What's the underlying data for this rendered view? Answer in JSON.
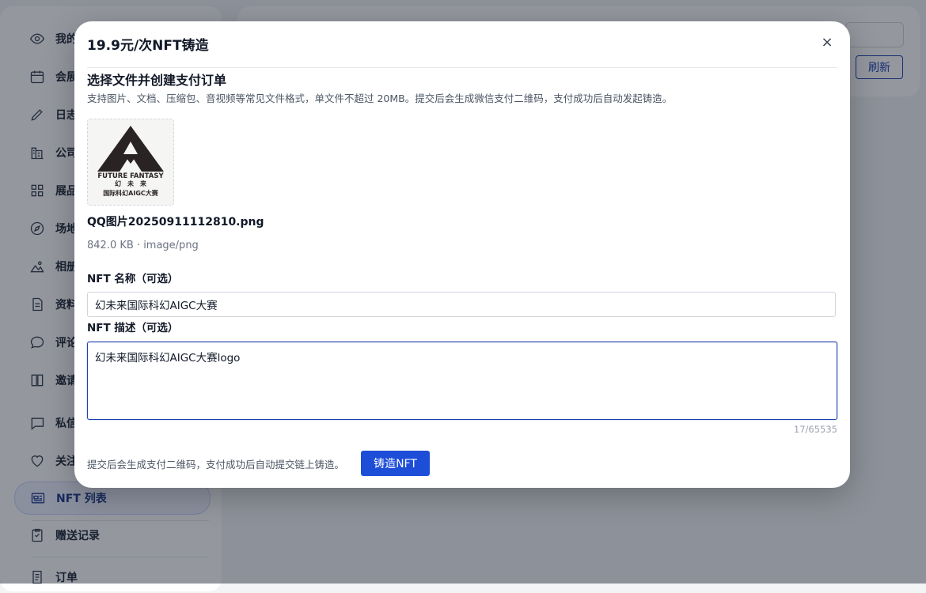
{
  "sidebar": {
    "items": [
      {
        "label": "我的",
        "icon": "eye-icon"
      },
      {
        "label": "会展",
        "icon": "calendar-icon"
      },
      {
        "label": "日志",
        "icon": "pencil-icon"
      },
      {
        "label": "公司",
        "icon": "building-icon"
      },
      {
        "label": "展品",
        "icon": "grid-icon"
      },
      {
        "label": "场地",
        "icon": "compass-icon"
      },
      {
        "label": "相册",
        "icon": "image-icon"
      },
      {
        "label": "资料",
        "icon": "document-icon"
      },
      {
        "label": "评论",
        "icon": "chat-bubble-icon"
      },
      {
        "label": "邀请",
        "icon": "book-icon"
      },
      {
        "label": "私信",
        "icon": "message-icon"
      },
      {
        "label": "关注",
        "icon": "heart-icon"
      },
      {
        "label": "NFT 列表",
        "icon": "nft-card-icon",
        "active": true
      },
      {
        "label": "赠送记录",
        "icon": "checklist-icon"
      },
      {
        "label": "订单",
        "icon": "receipt-icon"
      }
    ]
  },
  "header": {
    "refresh_label": "刷新"
  },
  "modal": {
    "title": "19.9元/次NFT铸造",
    "close_label": "×",
    "section_title": "选择文件并创建支付订单",
    "section_subtitle": "支持图片、文档、压缩包、音视频等常见文件格式，单文件不超过 20MB。提交后会生成微信支付二维码，支付成功后自动发起铸造。",
    "file": {
      "name": "QQ图片20250911112810.png",
      "meta": "842.0 KB · image/png",
      "logo_text_en": "FUTURE FANTASY",
      "logo_text_cn": "幻　未　来",
      "logo_text_sub": "国际科幻AIGC大赛"
    },
    "name_label": "NFT 名称（可选）",
    "name_value": "幻未来国际科幻AIGC大赛",
    "desc_label": "NFT 描述（可选）",
    "desc_value": "幻未来国际科幻AIGC大赛logo",
    "char_count": "17/65535",
    "footer_note": "提交后会生成支付二维码，支付成功后自动提交链上铸造。",
    "mint_label": "铸造NFT"
  },
  "colors": {
    "primary": "#1d4ed8",
    "overlay": "rgba(17,24,39,0.45)"
  }
}
